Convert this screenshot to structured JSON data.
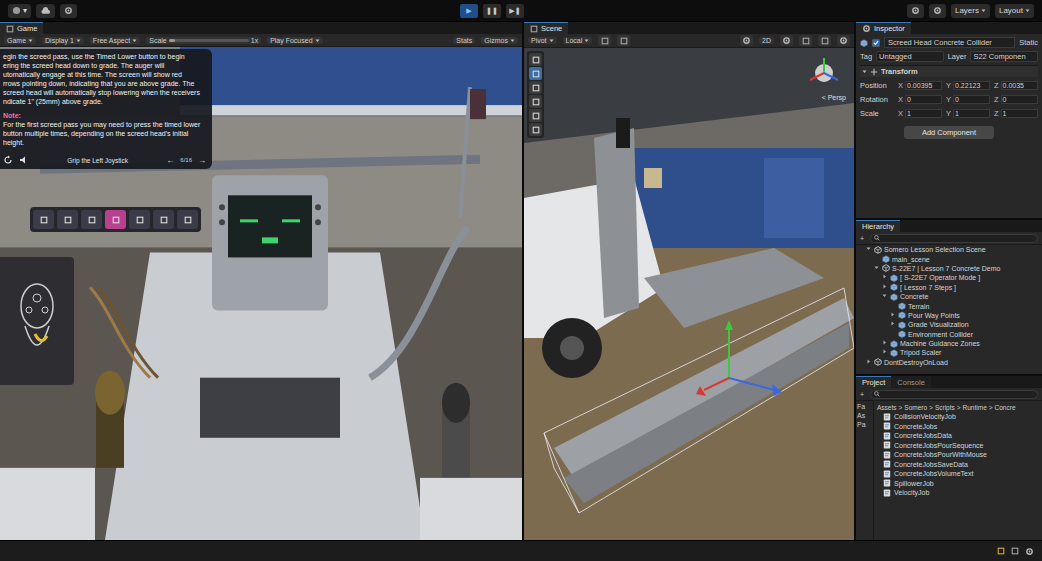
{
  "toolbar": {
    "account": "▾",
    "controls": [
      {
        "icon": "▶",
        "selected": true
      },
      {
        "icon": "❚❚",
        "selected": false
      },
      {
        "icon": "▶❚",
        "selected": false
      }
    ],
    "layers": "Layers",
    "layout": "Layout"
  },
  "game": {
    "tab": "Game",
    "toolbar": [
      {
        "kind": "dropdown",
        "label": "Game"
      },
      {
        "kind": "dropdown",
        "label": "Display 1"
      },
      {
        "kind": "dropdown",
        "label": "Free Aspect"
      },
      {
        "kind": "slider",
        "label": "Scale",
        "level": 0.08,
        "reading": "1x"
      },
      {
        "kind": "dropdown",
        "label": "Play Focused"
      },
      {
        "kind": "button",
        "label": "Stats"
      },
      {
        "kind": "dropdown",
        "label": "Gizmos"
      }
    ],
    "instructions": {
      "lines": [
        "egin the screed pass, use the Timed Lower button to begin",
        "ering the screed head down to grade. The auger will",
        "utomatically engage at this time. The screen will show red",
        "rrows pointing down, indicating that you are above grade. The",
        "screed head will automatically stop lowering when the receivers",
        "ndicate 1\" (25mm) above grade."
      ],
      "note_title": "Note:",
      "note_lines": [
        "For the first screed pass you may need to press the timed lower",
        "button multiple times, depending on the screed head's initial",
        "height."
      ],
      "hint": "Grip the Left Joystick",
      "page": "6/16",
      "prev": "←",
      "next": "→"
    },
    "menu_buttons": [
      {
        "selected": false
      },
      {
        "selected": false
      },
      {
        "selected": false
      },
      {
        "selected": true
      },
      {
        "selected": false
      },
      {
        "selected": false
      },
      {
        "selected": false
      }
    ]
  },
  "scene": {
    "tab": "Scene",
    "toolbar": [
      {
        "kind": "dropdown",
        "label": "Pivot",
        "selected": false
      },
      {
        "kind": "dropdown",
        "label": "Local",
        "selected": false
      },
      {
        "kind": "button",
        "label": "2D",
        "selected": false
      }
    ],
    "tools": [
      {
        "selected": false
      },
      {
        "selected": true
      },
      {
        "selected": false
      },
      {
        "selected": false
      },
      {
        "selected": false
      },
      {
        "selected": false
      }
    ],
    "persp": "< Persp"
  },
  "inspector": {
    "tab": "Inspector",
    "enabled": true,
    "name": "Screed Head Concrete Collider",
    "static": "Static",
    "tag": {
      "label": "Tag",
      "value": "Untagged"
    },
    "layer": {
      "label": "Layer",
      "value": "S22 Componen"
    },
    "transform": {
      "title": "Transform",
      "expanded": true,
      "rows": [
        {
          "label": "Position",
          "values": [
            {
              "axis": "X",
              "value": "0.00395"
            },
            {
              "axis": "Y",
              "value": "0.22123"
            },
            {
              "axis": "Z",
              "value": "0.0035"
            }
          ]
        },
        {
          "label": "Rotation",
          "values": [
            {
              "axis": "X",
              "value": "0"
            },
            {
              "axis": "Y",
              "value": "0"
            },
            {
              "axis": "Z",
              "value": "0"
            }
          ]
        },
        {
          "label": "Scale",
          "values": [
            {
              "axis": "X",
              "value": "1"
            },
            {
              "axis": "Y",
              "value": "1"
            },
            {
              "axis": "Z",
              "value": "1"
            }
          ]
        }
      ]
    },
    "add_component": "Add Component"
  },
  "hierarchy": {
    "tab": "Hierarchy",
    "add": "+",
    "items": [
      {
        "label": "Somero Lesson Selection Scene",
        "kind": "scene",
        "has_children": true,
        "expanded": true,
        "children": [
          {
            "label": "main_scene",
            "kind": "object",
            "has_children": false,
            "expanded": false,
            "children": []
          },
          {
            "label": "S-22E7 | Lesson 7 Concrete Demo",
            "kind": "scene",
            "has_children": true,
            "expanded": true,
            "children": [
              {
                "label": "[ S-22E7 Operator Mode ]",
                "kind": "object",
                "has_children": true,
                "expanded": false,
                "children": []
              },
              {
                "label": "[ Lesson 7 Steps ]",
                "kind": "object",
                "has_children": true,
                "expanded": false,
                "children": []
              },
              {
                "label": "Concrete",
                "kind": "object",
                "has_children": true,
                "expanded": true,
                "children": [
                  {
                    "label": "Terrain",
                    "kind": "object",
                    "has_children": false,
                    "expanded": false,
                    "children": []
                  },
                  {
                    "label": "Pour Way Points",
                    "kind": "object",
                    "has_children": true,
                    "expanded": false,
                    "children": []
                  },
                  {
                    "label": "Grade Visualization",
                    "kind": "object",
                    "has_children": true,
                    "expanded": false,
                    "children": []
                  },
                  {
                    "label": "Environment Collider",
                    "kind": "object",
                    "has_children": false,
                    "expanded": false,
                    "children": []
                  }
                ]
              },
              {
                "label": "Machine Guidance Zones",
                "kind": "object",
                "has_children": true,
                "expanded": false,
                "children": []
              },
              {
                "label": "Tripod Scaler",
                "kind": "object",
                "has_children": true,
                "expanded": false,
                "children": []
              }
            ]
          }
        ]
      },
      {
        "label": "DontDestroyOnLoad",
        "kind": "scene",
        "has_children": true,
        "expanded": false,
        "children": []
      }
    ]
  },
  "project": {
    "tabs": [
      {
        "label": "Project",
        "selected": true
      },
      {
        "label": "Console",
        "selected": false
      }
    ],
    "add": "+",
    "breadcrumb": [
      "Assets",
      "Somero",
      "Scripts",
      "Runtime",
      "Concre"
    ],
    "separator": ">",
    "folders": [
      "Fa",
      "As",
      "Pa"
    ],
    "files": [
      "CollisionVelocityJob",
      "ConcreteJobs",
      "ConcreteJobsData",
      "ConcreteJobsPourSequence",
      "ConcreteJobsPourWithMouse",
      "ConcreteJobsSaveData",
      "ConcreteJobsVolumeText",
      "SpillowerJob",
      "VelocityJob"
    ]
  }
}
